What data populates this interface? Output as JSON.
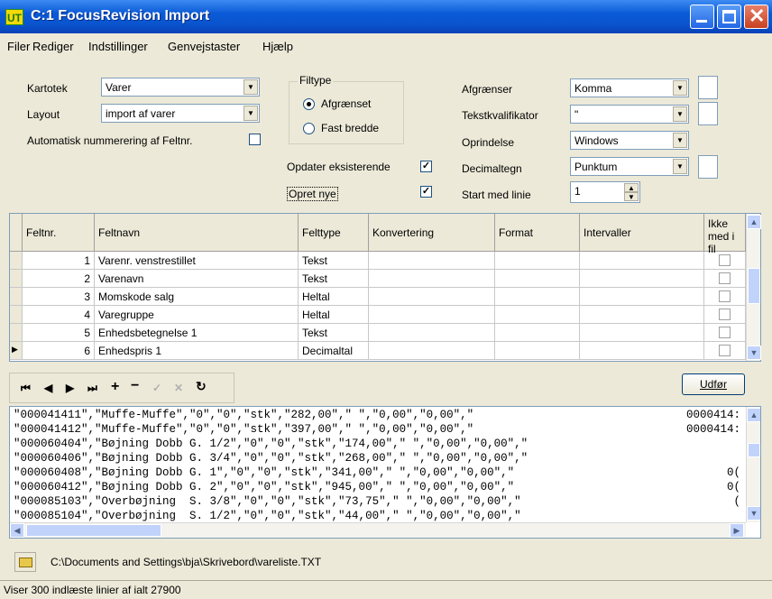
{
  "window": {
    "title": "C:1 FocusRevision Import",
    "icon_text": "UT"
  },
  "menu": [
    "Filer",
    "Rediger",
    "Indstillinger",
    "Genvejstaster",
    "Hjælp"
  ],
  "form": {
    "kartotek_label": "Kartotek",
    "kartotek_value": "Varer",
    "layout_label": "Layout",
    "layout_value": "import af varer",
    "auto_num_label": "Automatisk nummerering af Feltnr.",
    "filtype_legend": "Filtype",
    "filtype_options": [
      "Afgrænset",
      "Fast bredde"
    ],
    "filtype_selected": "Afgrænset",
    "opdater_label": "Opdater eksisterende",
    "opdater_checked": "✓",
    "opret_label": "Opret nye",
    "opret_checked": "✓",
    "afgraenser_label": "Afgrænser",
    "afgraenser_value": "Komma",
    "tekstkval_label": "Tekstkvalifikator",
    "tekstkval_value": "\"",
    "oprindelse_label": "Oprindelse",
    "oprindelse_value": "Windows",
    "decimaltegn_label": "Decimaltegn",
    "decimaltegn_value": "Punktum",
    "startlinie_label": "Start med linie",
    "startlinie_value": "1"
  },
  "grid": {
    "columns": [
      "Feltnr.",
      "Feltnavn",
      "Felttype",
      "Konvertering",
      "Format",
      "Intervaller",
      "Ikke med i fil"
    ],
    "rows": [
      {
        "nr": "1",
        "navn": "Varenr. venstrestillet",
        "type": "Tekst"
      },
      {
        "nr": "2",
        "navn": "Varenavn",
        "type": "Tekst"
      },
      {
        "nr": "3",
        "navn": "Momskode salg",
        "type": "Heltal"
      },
      {
        "nr": "4",
        "navn": "Varegruppe",
        "type": "Heltal"
      },
      {
        "nr": "5",
        "navn": "Enhedsbetegnelse 1",
        "type": "Tekst"
      },
      {
        "nr": "6",
        "navn": "Enhedspris 1",
        "type": "Decimaltal"
      }
    ]
  },
  "toolbar": {
    "udfor_label": "Udfør"
  },
  "preview": {
    "lines": [
      "\"000041411\",\"Muffe-Muffe\",\"0\",\"0\",\"stk\",\"282,00\",\" \",\"0,00\",\"0,00\",\"",
      "\"000041412\",\"Muffe-Muffe\",\"0\",\"0\",\"stk\",\"397,00\",\" \",\"0,00\",\"0,00\",\"",
      "\"000060404\",\"Bøjning Dobb G. 1/2\",\"0\",\"0\",\"stk\",\"174,00\",\" \",\"0,00\",\"0,00\",\"",
      "\"000060406\",\"Bøjning Dobb G. 3/4\",\"0\",\"0\",\"stk\",\"268,00\",\" \",\"0,00\",\"0,00\",\"",
      "\"000060408\",\"Bøjning Dobb G. 1\",\"0\",\"0\",\"stk\",\"341,00\",\" \",\"0,00\",\"0,00\",\"",
      "\"000060412\",\"Bøjning Dobb G. 2\",\"0\",\"0\",\"stk\",\"945,00\",\" \",\"0,00\",\"0,00\",\"",
      "\"000085103\",\"Overbøjning  S. 3/8\",\"0\",\"0\",\"stk\",\"73,75\",\" \",\"0,00\",\"0,00\",\"",
      "\"000085104\",\"Overbøjning  S. 1/2\",\"0\",\"0\",\"stk\",\"44,00\",\" \",\"0,00\",\"0,00\",\""
    ],
    "right_col": [
      "0000414:",
      "0000414:",
      "",
      "",
      "0(",
      "0(",
      "(",
      ""
    ]
  },
  "file_path": "C:\\Documents and Settings\\bja\\Skrivebord\\vareliste.TXT",
  "status": "Viser 300 indlæste linier af ialt 27900"
}
